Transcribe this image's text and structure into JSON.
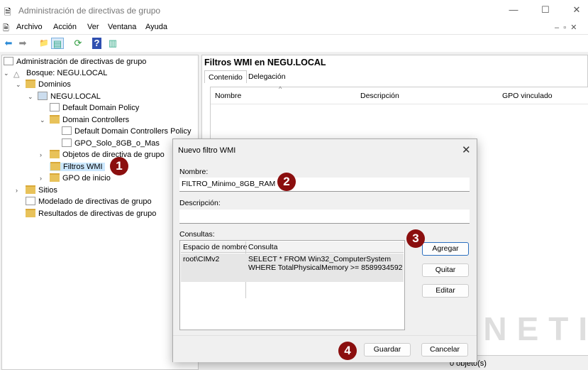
{
  "window": {
    "title": "Administración de directivas de grupo",
    "controls": [
      "—",
      "☐",
      "✕"
    ]
  },
  "menu": [
    "Archivo",
    "Acción",
    "Ver",
    "Ventana",
    "Ayuda"
  ],
  "toolbar": [
    {
      "icon": "back-arrow-icon",
      "glyph": "⬅"
    },
    {
      "icon": "forward-arrow-icon",
      "glyph": "➡"
    },
    {
      "icon": "up-folder-icon",
      "glyph": "📁"
    },
    {
      "icon": "show-hide-tree-icon",
      "glyph": "▤"
    },
    {
      "icon": "refresh-icon",
      "glyph": "⟳"
    },
    {
      "icon": "help-icon",
      "glyph": "?"
    },
    {
      "icon": "action-pane-icon",
      "glyph": "▥"
    }
  ],
  "tree": {
    "items": [
      {
        "label": "Administración de directivas de grupo",
        "chev": "",
        "icon": "gpmc"
      },
      {
        "label": "Bosque: NEGU.LOCAL",
        "chev": "⌄",
        "icon": "forest"
      },
      {
        "label": "Dominios",
        "chev": "⌄",
        "icon": "folder"
      },
      {
        "label": "NEGU.LOCAL",
        "chev": "⌄",
        "icon": "domain"
      },
      {
        "label": "Default Domain Policy",
        "chev": "",
        "icon": "gpo"
      },
      {
        "label": "Domain Controllers",
        "chev": "⌄",
        "icon": "folder"
      },
      {
        "label": "Default Domain Controllers Policy",
        "chev": "",
        "icon": "gpo"
      },
      {
        "label": "GPO_Solo_8GB_o_Mas",
        "chev": "",
        "icon": "gpo"
      },
      {
        "label": "Objetos de directiva de grupo",
        "chev": "›",
        "icon": "folder"
      },
      {
        "label": "Filtros WMI",
        "chev": "",
        "icon": "folder",
        "selected": true
      },
      {
        "label": "GPO de inicio",
        "chev": "›",
        "icon": "folder"
      },
      {
        "label": "Sitios",
        "chev": "›",
        "icon": "folder"
      },
      {
        "label": "Modelado de directivas de grupo",
        "chev": "",
        "icon": "gpo"
      },
      {
        "label": "Resultados de directivas de grupo",
        "chev": "",
        "icon": "folder"
      }
    ]
  },
  "right": {
    "header": "Filtros WMI en NEGU.LOCAL",
    "tabs": [
      "Contenido",
      "Delegación"
    ],
    "columns": [
      "Nombre",
      "Descripción",
      "GPO vinculado"
    ],
    "status": "0 objeto(s)"
  },
  "dialog": {
    "title": "Nuevo filtro WMI",
    "name_label": "Nombre:",
    "name_value": "FILTRO_Minimo_8GB_RAM",
    "desc_label": "Descripción:",
    "desc_value": "",
    "queries_label": "Consultas:",
    "query_columns": [
      "Espacio de nombre",
      "Consulta"
    ],
    "queries": [
      {
        "namespace": "root\\CIMv2",
        "query_line1": "SELECT * FROM Win32_ComputerSystem",
        "query_line2": "WHERE TotalPhysicalMemory >= 8589934592"
      }
    ],
    "buttons": {
      "add": "Agregar",
      "remove": "Quitar",
      "edit": "Editar",
      "save": "Guardar",
      "cancel": "Cancelar"
    }
  },
  "badges": [
    "1",
    "2",
    "3",
    "4"
  ],
  "watermark": "GEEKNETIC",
  "colors": {
    "badge": "#8b0f0f",
    "selection": "#cce8ff"
  }
}
